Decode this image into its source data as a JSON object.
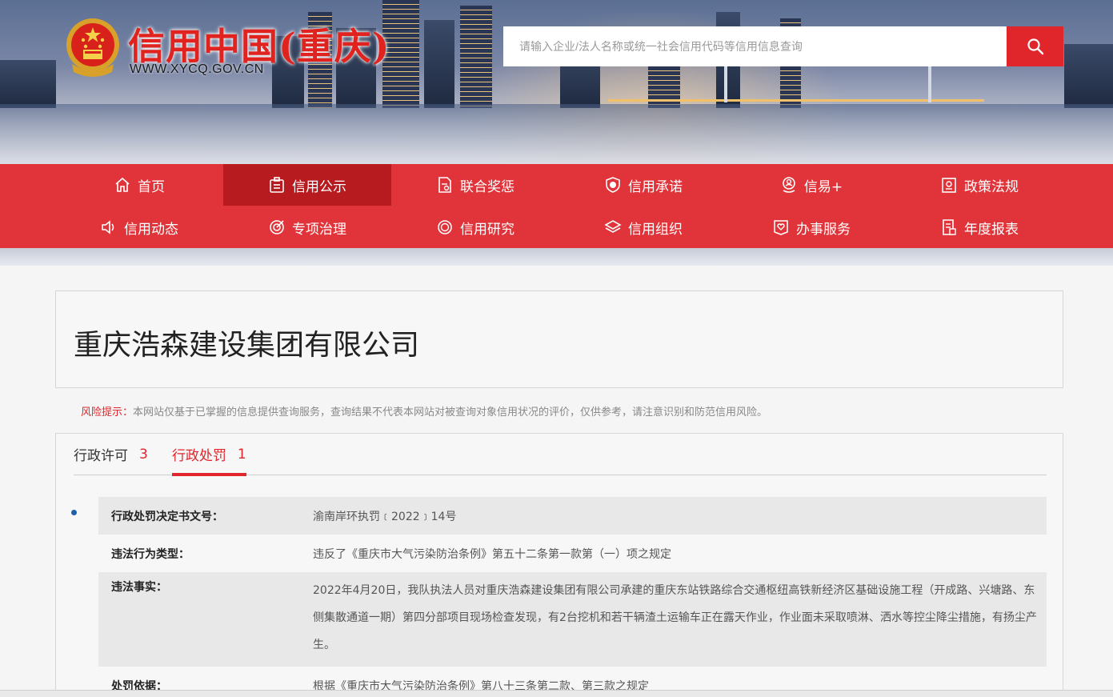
{
  "header": {
    "title": "信用中国(重庆)",
    "url": "WWW.XYCQ.GOV.CN",
    "search_placeholder": "请输入企业/法人名称或统一社会信用代码等信用信息查询"
  },
  "nav": {
    "row1": [
      {
        "label": "首页",
        "icon": "home-icon"
      },
      {
        "label": "信用公示",
        "icon": "notice-icon",
        "active": true
      },
      {
        "label": "联合奖惩",
        "icon": "document-icon"
      },
      {
        "label": "信用承诺",
        "icon": "shield-icon"
      },
      {
        "label": "信易+",
        "icon": "person-pin-icon"
      },
      {
        "label": "政策法规",
        "icon": "certificate-icon"
      }
    ],
    "row2": [
      {
        "label": "信用动态",
        "icon": "speaker-icon"
      },
      {
        "label": "专项治理",
        "icon": "target-icon"
      },
      {
        "label": "信用研究",
        "icon": "research-icon"
      },
      {
        "label": "信用组织",
        "icon": "layers-icon"
      },
      {
        "label": "办事服务",
        "icon": "service-heart-icon"
      },
      {
        "label": "年度报表",
        "icon": "report-icon"
      }
    ]
  },
  "company": {
    "name": "重庆浩森建设集团有限公司"
  },
  "risk": {
    "label": "风险提示：",
    "text": "本网站仅基于已掌握的信息提供查询服务，查询结果不代表本网站对被查询对象信用状况的评价，仅供参考，请注意识别和防范信用风险。"
  },
  "tabs": [
    {
      "label": "行政许可",
      "count": "3",
      "active": false
    },
    {
      "label": "行政处罚",
      "count": "1",
      "active": true
    }
  ],
  "penalty": {
    "decision_no": {
      "label": "行政处罚决定书文号：",
      "value": "渝南岸环执罚﹝2022﹞14号"
    },
    "violation_type": {
      "label": "违法行为类型：",
      "value": "违反了《重庆市大气污染防治条例》第五十二条第一款第（一）项之规定"
    },
    "facts": {
      "label": "违法事实：",
      "value": "2022年4月20日，我队执法人员对重庆浩森建设集团有限公司承建的重庆东站铁路综合交通枢纽高铁新经济区基础设施工程（开成路、兴塘路、东侧集散通道一期）第四分部项目现场检查发现，有2台挖机和若干辆渣土运输车正在露天作业，作业面未采取喷淋、洒水等控尘降尘措施，有扬尘产生。"
    },
    "basis": {
      "label": "处罚依据：",
      "value": "根据《重庆市大气污染防治条例》第八十三条第二款、第三款之规定"
    }
  },
  "colors": {
    "brand_red": "#e0262b",
    "nav_red": "#e0343a",
    "nav_active": "#b71a1f"
  }
}
